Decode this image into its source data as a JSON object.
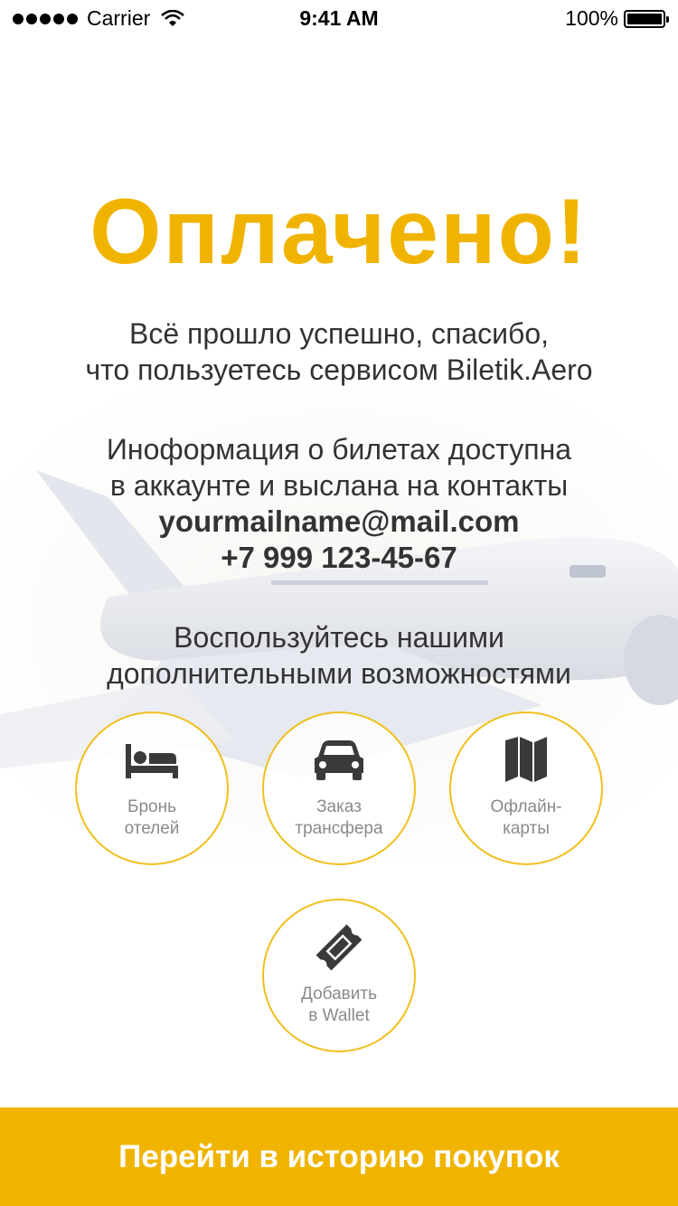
{
  "status_bar": {
    "carrier": "Carrier",
    "time": "9:41 AM",
    "battery": "100%"
  },
  "main": {
    "title": "Оплачено!",
    "success_line1": "Всё прошло успешно, спасибо,",
    "success_line2": "что пользуетесь сервисом Biletik.Aero",
    "info_line1": "Иноформация о билетах доступна",
    "info_line2": "в аккаунте и выслана на контакты",
    "email": "yourmailname@mail.com",
    "phone": "+7 999 123-45-67",
    "extras_line1": "Воспользуйтесь нашими",
    "extras_line2": "дополнительными возможностями"
  },
  "features": [
    {
      "line1": "Бронь",
      "line2": "отелей",
      "icon": "bed-icon"
    },
    {
      "line1": "Заказ",
      "line2": "трансфера",
      "icon": "car-icon"
    },
    {
      "line1": "Офлайн-",
      "line2": "карты",
      "icon": "map-icon"
    },
    {
      "line1": "Добавить",
      "line2": "в Wallet",
      "icon": "ticket-icon"
    }
  ],
  "cta": {
    "label": "Перейти в историю покупок"
  },
  "colors": {
    "accent": "#f0b400",
    "text": "#333333",
    "muted": "#8a8a8a"
  }
}
